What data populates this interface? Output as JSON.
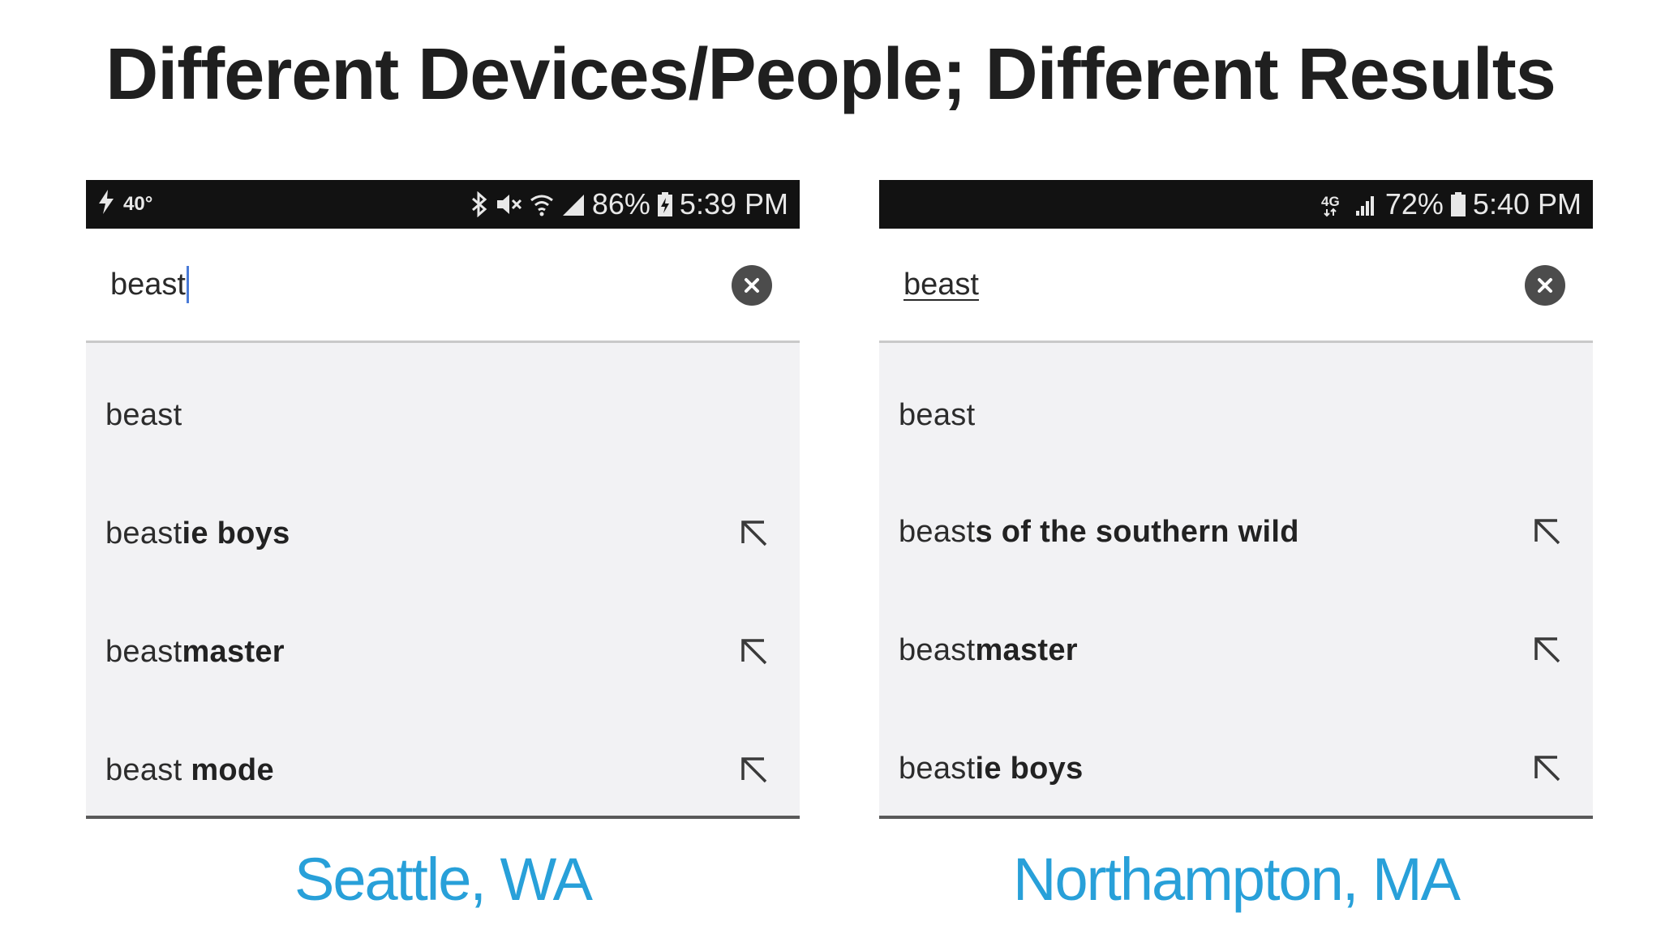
{
  "title": "Different Devices/People; Different Results",
  "colors": {
    "caption": "#28a0d9",
    "status_bar": "#121212",
    "dropdown_bg": "#f2f2f4",
    "cursor": "#4a7bd8"
  },
  "left": {
    "caption": "Seattle, WA",
    "status": {
      "temperature": "40°",
      "battery": "86%",
      "time": "5:39 PM",
      "icons": [
        "flash-icon",
        "bluetooth-icon",
        "mute-icon",
        "wifi-icon",
        "signal-icon",
        "battery-charging-icon"
      ]
    },
    "query": "beast",
    "suggestions": [
      {
        "prefix": "beast",
        "bold": "",
        "has_arrow": false
      },
      {
        "prefix": "beast",
        "bold": "ie boys",
        "has_arrow": true
      },
      {
        "prefix": "beast",
        "bold": "master",
        "has_arrow": true
      },
      {
        "prefix": "beast ",
        "bold": "mode",
        "has_arrow": true
      }
    ]
  },
  "right": {
    "caption": "Northampton, MA",
    "status": {
      "network": "4G",
      "battery": "72%",
      "time": "5:40 PM",
      "icons": [
        "4g-icon",
        "signal-icon",
        "battery-icon"
      ]
    },
    "query": "beast",
    "suggestions": [
      {
        "prefix": "beast",
        "bold": "",
        "has_arrow": false
      },
      {
        "prefix": "beast",
        "bold": "s of the southern wild",
        "has_arrow": true
      },
      {
        "prefix": "beast",
        "bold": "master",
        "has_arrow": true
      },
      {
        "prefix": "beast",
        "bold": "ie boys",
        "has_arrow": true
      }
    ]
  }
}
